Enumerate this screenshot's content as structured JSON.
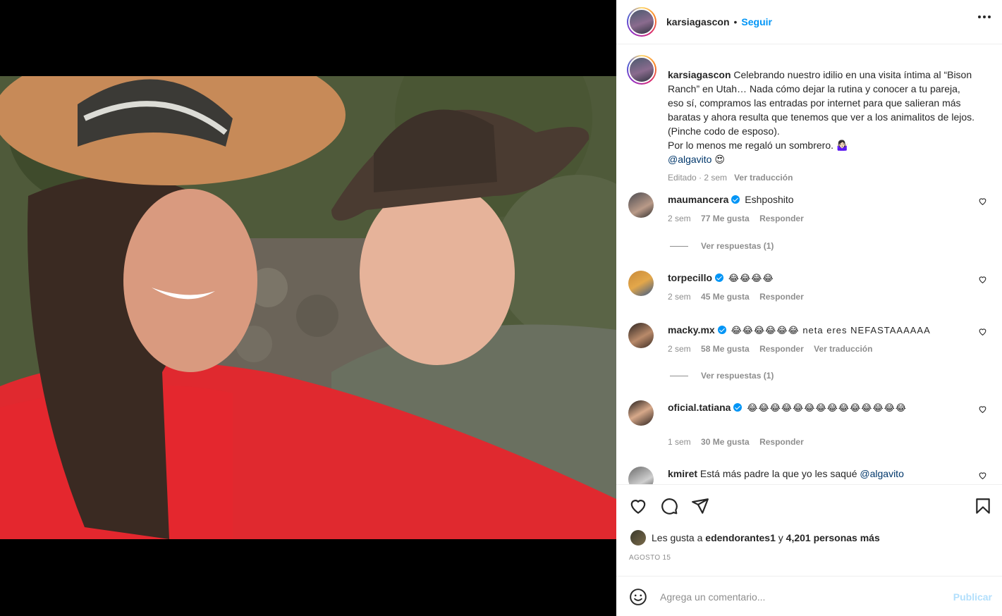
{
  "post": {
    "username": "karsiagascon",
    "dot": "•",
    "follow_label": "Seguir"
  },
  "caption": {
    "username": "karsiagascon",
    "text": "Celebrando nuestro idilio en una visita íntima al “Bison Ranch” en Utah… Nada cómo dejar la rutina y conocer a tu pareja, eso sí, compramos las entradas por internet para que salieran más baratas y ahora resulta que tenemos que ver a los animalitos de lejos. (Pinche codo de esposo).",
    "line2": "Por lo menos me regaló un sombrero. 🤷🏻‍♀️",
    "mention": "@algavito",
    "mention_emoji": "😍",
    "edited": "Editado · 2 sem",
    "translate": "Ver traducción"
  },
  "comments": [
    {
      "user": "maumancera",
      "verified": true,
      "text": "Eshposhito",
      "time": "2 sem",
      "likes": "77 Me gusta",
      "reply": "Responder",
      "view_replies": "Ver respuestas (1)"
    },
    {
      "user": "torpecillo",
      "verified": true,
      "text": "😂😂😂😂",
      "time": "2 sem",
      "likes": "45 Me gusta",
      "reply": "Responder"
    },
    {
      "user": "macky.mx",
      "verified": true,
      "text": "😂😂😂😂😂😂 neta eres NEFASTAAAAAA",
      "time": "2 sem",
      "likes": "58 Me gusta",
      "reply": "Responder",
      "translate": "Ver traducción",
      "view_replies": "Ver respuestas (1)"
    },
    {
      "user": "oficial.tatiana",
      "verified": true,
      "text": "😂😂😂😂😂😂😂😂😂😂😂😂😂😂",
      "time": "1 sem",
      "likes": "30 Me gusta",
      "reply": "Responder"
    },
    {
      "user": "kmiret",
      "verified": false,
      "text": "Está más padre la que yo les saqué",
      "mention": "@algavito"
    }
  ],
  "likes": {
    "prefix": "Les gusta a",
    "user": "edendorantes1",
    "and": "y",
    "others": "4,201 personas más"
  },
  "date": "AGOSTO 15",
  "add_comment": {
    "placeholder": "Agrega un comentario...",
    "publish": "Publicar"
  },
  "icons": [
    "more-icon",
    "heart-icon",
    "comment-icon",
    "share-icon",
    "bookmark-icon",
    "emoji-icon"
  ],
  "colors": {
    "link": "#0095f6",
    "muted": "#8e8e8e",
    "text": "#262626",
    "publish_disabled": "#b2dffc"
  }
}
